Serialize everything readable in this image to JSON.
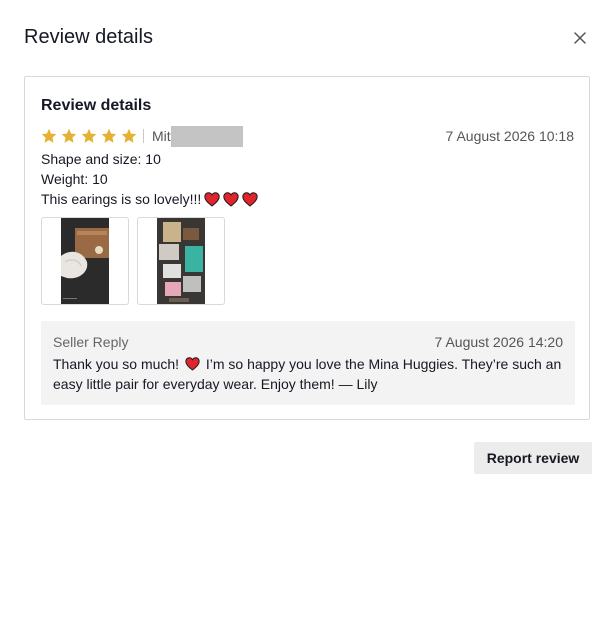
{
  "modal": {
    "title": "Review details",
    "close_icon": "close-icon"
  },
  "review": {
    "card_title": "Review details",
    "rating": 5,
    "rating_max": 5,
    "star_color": "#e5b130",
    "username_visible": "Mit",
    "timestamp": "7 August 2026 10:18",
    "attributes": [
      {
        "text": "Shape and size: 10"
      },
      {
        "text": "Weight: 10"
      }
    ],
    "comment": "This earings is so lovely!!!",
    "comment_emoji": [
      "heart-emoji",
      "heart-emoji",
      "heart-emoji"
    ],
    "images": [
      {
        "name": "review-photo-1"
      },
      {
        "name": "review-photo-2"
      }
    ]
  },
  "seller_reply": {
    "label": "Seller Reply",
    "timestamp": "7 August 2026 14:20",
    "text_before_emoji": "Thank you so much!",
    "text_after_emoji": "I’m so happy you love the Mina Huggies. They’re such an easy little pair for everyday wear. Enjoy them! — Lily"
  },
  "actions": {
    "report_label": "Report review"
  },
  "colors": {
    "heart": "#e0242c",
    "reply_background": "#f3f3f3",
    "button_background": "#ececec"
  }
}
